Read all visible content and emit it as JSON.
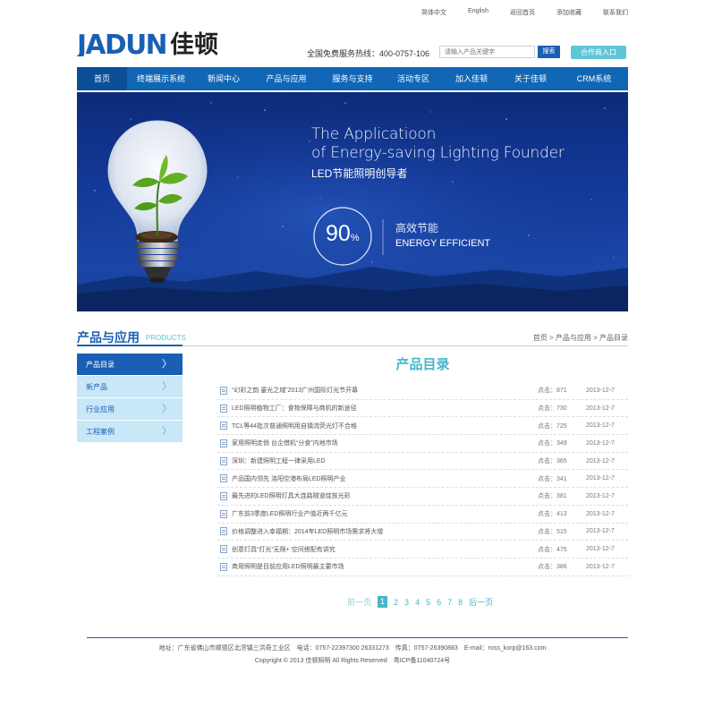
{
  "top_links": [
    "简体中文",
    "English",
    "返回首页",
    "添加收藏",
    "联系我们"
  ],
  "header": {
    "logo_text": "JADUN佳顿",
    "hotline": "全国免费服务热线：400-0757-106",
    "search_placeholder": "请输入产品关键字",
    "search_button": "搜索",
    "partner_button": "合作商入口"
  },
  "nav": {
    "items": [
      {
        "label": "首页",
        "active": true
      },
      {
        "label": "终端展示系统",
        "active": false
      },
      {
        "label": "新闻中心",
        "active": false
      },
      {
        "label": "产品与应用",
        "active": false
      },
      {
        "label": "服务与支持",
        "active": false
      },
      {
        "label": "活动专区",
        "active": false
      },
      {
        "label": "加入佳顿",
        "active": false
      },
      {
        "label": "关于佳顿",
        "active": false
      },
      {
        "label": "CRM系统",
        "active": false
      }
    ]
  },
  "banner": {
    "line1": "The Applicatioon",
    "line2": "of Energy-saving Lighting Founder",
    "line3": "LED节能照明创导者",
    "percent": "90",
    "percent_sign": "%",
    "eff_cn": "高效节能",
    "eff_en": "ENERGY EFFICIENT"
  },
  "section": {
    "title": "产品与应用",
    "subtitle": "PRODUCTS",
    "breadcrumb": "首页 > 产品与应用 > 产品目录"
  },
  "sidebar": {
    "items": [
      {
        "label": "产品目录",
        "active": true
      },
      {
        "label": "新产品",
        "active": false
      },
      {
        "label": "行业应用",
        "active": false
      },
      {
        "label": "工程案例",
        "active": false
      }
    ]
  },
  "content": {
    "title": "产品目录",
    "hits_label": "点击：",
    "rows": [
      {
        "title": "“幻彩之韵 鎏光之城”2013广州国际灯光节开幕",
        "hits": "871",
        "date": "2013-12-7"
      },
      {
        "title": "LED照明植物工厂：食物保障与商机的新途径",
        "hits": "730",
        "date": "2013-12-7"
      },
      {
        "title": "TCL等44批次普通照明用自镇流荧光灯不合格",
        "hits": "725",
        "date": "2013-12-7"
      },
      {
        "title": "家用照明走俏 台企借机“分食”内地市场",
        "hits": "349",
        "date": "2013-12-7"
      },
      {
        "title": "深圳：新建照明工程一律采用LED",
        "hits": "365",
        "date": "2013-12-7"
      },
      {
        "title": "产品国内领先 洛阳空港布局LED照明产业",
        "hits": "341",
        "date": "2013-12-7"
      },
      {
        "title": "最先进的LED照明灯具大连路隧道绽放光彩",
        "hits": "381",
        "date": "2013-12-7"
      },
      {
        "title": "广东前3季度LED照明行业产值近两千亿元",
        "hits": "413",
        "date": "2013-12-7"
      },
      {
        "title": "价格调整进入幸福期：2014年LED照明市场需求将大增",
        "hits": "515",
        "date": "2013-12-7"
      },
      {
        "title": "创意灯具“灯光”无限+ 空间搭配有讲究",
        "hits": "475",
        "date": "2013-12-7"
      },
      {
        "title": "商用照明是目前应用LED照明最主要市场",
        "hits": "386",
        "date": "2013-12-7"
      }
    ]
  },
  "pager": {
    "prev": "前一页",
    "pages": [
      "1",
      "2",
      "3",
      "4",
      "5",
      "6",
      "7",
      "8"
    ],
    "current": "1",
    "next": "后一页"
  },
  "footer": {
    "line1": "地址：广东省佛山市顺德区北滘镇三洪奇工业区　电话：0757-22397300 26331273　传真：0757-26390883　E-mail：ross_korp@163.com",
    "line2": "Copyright © 2013 佳顿照明 All Rights Reserved　粤ICP备11040724号"
  },
  "colors": {
    "brand_blue": "#1167b6",
    "accent_cyan": "#45b7c9",
    "sidebar_light": "#c8e7f7"
  }
}
